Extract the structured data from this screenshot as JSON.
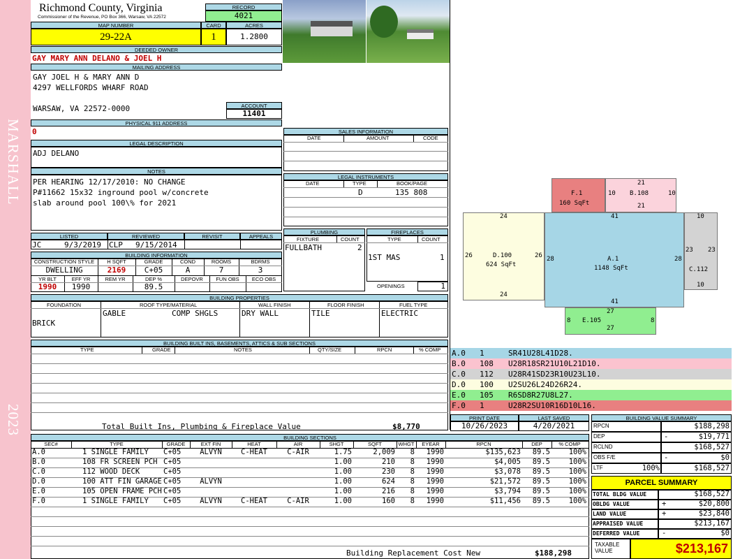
{
  "sidebar": {
    "top_text": "MARSHALL",
    "bottom_text": "2023"
  },
  "header": {
    "county": "Richmond County, Virginia",
    "commissioner": "Commissioner of the Revenue, PO Box 366, Warsaw, VA 22572",
    "record_label": "RECORD",
    "record": "4021",
    "map_number_label": "MAP NUMBER",
    "map_number": "29-22A",
    "card_label": "CARD",
    "card": "1",
    "acres_label": "ACRES",
    "acres": "1.2800"
  },
  "owner": {
    "deeded_label": "DEEDED OWNER",
    "deeded": "GAY MARY ANN DELANO & JOEL H",
    "mailing_label": "MAILING ADDRESS",
    "mailing": [
      "GAY JOEL H & MARY ANN D",
      "4297 WELLFORDS WHARF ROAD",
      "",
      "WARSAW, VA 22572-0000"
    ],
    "account_label": "ACCOUNT",
    "account": "11401",
    "physical_label": "PHYSICAL 911 ADDRESS",
    "physical": "0"
  },
  "legal": {
    "label": "LEGAL DESCRIPTION",
    "text": "ADJ DELANO"
  },
  "notes": {
    "label": "NOTES",
    "lines": [
      "PER HEARING 12/17/2010: NO CHANGE",
      "P#11662 15x32 inground pool w/concrete",
      "slab around pool 100\\% for 2021"
    ]
  },
  "review": {
    "listed_label": "LISTED",
    "listed_by": "JC",
    "listed_date": "9/3/2019",
    "reviewed_label": "REVIEWED",
    "reviewed_by": "CLP",
    "reviewed_date": "9/15/2014",
    "revisit_label": "REVISIT",
    "appeals_label": "APPEALS"
  },
  "building_info": {
    "label": "BUILDING INFORMATION",
    "headers": [
      "CONSTRUCTION STYLE",
      "H SQFT",
      "GRADE",
      "COND",
      "ROOMS",
      "BDRMS"
    ],
    "values": [
      "DWELLING",
      "2169",
      "C+05",
      "A",
      "7",
      "3"
    ],
    "headers2": [
      "YR BLT",
      "EFF YR",
      "REM YR",
      "DEP %",
      "DEPOVR",
      "FUN OBS",
      "ECO OBS"
    ],
    "values2": [
      "1990",
      "1990",
      "",
      "89.5",
      "",
      "",
      ""
    ]
  },
  "sales": {
    "label": "SALES INFORMATION",
    "headers": [
      "DATE",
      "AMOUNT",
      "CODE"
    ]
  },
  "instruments": {
    "label": "LEGAL INSTRUMENTS",
    "headers": [
      "DATE",
      "TYPE",
      "BOOK/PAGE"
    ],
    "row": [
      "",
      "D",
      "135 808"
    ]
  },
  "plumbing": {
    "label": "PLUMBING",
    "headers": [
      "FIXTURE",
      "COUNT"
    ],
    "fixture": "FULLBATH",
    "count": "2"
  },
  "fireplaces": {
    "label": "FIREPLACES",
    "headers": [
      "TYPE",
      "COUNT"
    ],
    "type": "1ST MAS",
    "count": "1",
    "openings_label": "OPENINGS",
    "openings": "1"
  },
  "properties": {
    "label": "BUILDING PROPERTIES",
    "headers": [
      "FOUNDATION",
      "ROOF TYPE/MATERIAL",
      "WALL FINISH",
      "FLOOR FINISH",
      "FUEL TYPE"
    ],
    "foundation": "BRICK",
    "roof_type": "GABLE",
    "roof_material": "COMP SHGLS",
    "wall": "DRY WALL",
    "floor": "TILE",
    "fuel": "ELECTRIC"
  },
  "builtins": {
    "label": "BUILDING BUILT INS, BASEMENTS, ATTICS & SUB SECTIONS",
    "headers": [
      "TYPE",
      "GRADE",
      "NOTES",
      "QTY/SIZE",
      "RPCN",
      "% COMP"
    ],
    "total_label": "Total Built Ins, Plumbing & Fireplace Value",
    "total": "$8,770"
  },
  "dates": {
    "print_label": "PRINT DATE",
    "print": "10/26/2023",
    "saved_label": "LAST SAVED",
    "saved": "4/20/2021"
  },
  "sections": {
    "label": "BUILDING SECTIONS",
    "headers": [
      "SEC#",
      "TYPE",
      "GRADE",
      "EXT FIN",
      "HEAT",
      "AIR",
      "SHGT",
      "SQFT",
      "WHGT",
      "EYEAR",
      "RPCN",
      "DEP",
      "% COMP"
    ],
    "rows": [
      [
        "A.0",
        "1 SINGLE FAMILY",
        "C+05",
        "ALVYN",
        "C-HEAT",
        "C-AIR",
        "1.75",
        "2,009",
        "8",
        "1990",
        "$135,623",
        "89.5",
        "100%"
      ],
      [
        "B.0",
        "108 FR SCREEN PCH",
        "C+05",
        "",
        "",
        "",
        "1.00",
        "210",
        "8",
        "1990",
        "$4,005",
        "89.5",
        "100%"
      ],
      [
        "C.0",
        "112 WOOD DECK",
        "C+05",
        "",
        "",
        "",
        "1.00",
        "230",
        "8",
        "1990",
        "$3,078",
        "89.5",
        "100%"
      ],
      [
        "D.0",
        "100 ATT FIN GARAGE",
        "C+05",
        "ALVYN",
        "",
        "",
        "1.00",
        "624",
        "8",
        "1990",
        "$21,572",
        "89.5",
        "100%"
      ],
      [
        "E.0",
        "105 OPEN FRAME PCH",
        "C+05",
        "",
        "",
        "",
        "1.00",
        "216",
        "8",
        "1990",
        "$3,794",
        "89.5",
        "100%"
      ],
      [
        "F.0",
        "1 SINGLE FAMILY",
        "C+05",
        "ALVYN",
        "C-HEAT",
        "C-AIR",
        "1.00",
        "160",
        "8",
        "1990",
        "$11,456",
        "89.5",
        "100%"
      ]
    ],
    "replacement_label": "Building Replacement Cost New",
    "replacement": "$188,298"
  },
  "sketch": {
    "areas": [
      {
        "id": "F.1",
        "sqft": "160 SqFt",
        "color": "#e88080"
      },
      {
        "id": "B.108",
        "color": "#fbd3dc"
      },
      {
        "id": "D.100",
        "sqft": "624 SqFt",
        "color": "#fdfde0"
      },
      {
        "id": "A.1",
        "sqft": "1148 SqFt",
        "color": "#a6d6e6"
      },
      {
        "id": "C.112",
        "color": "#d3d3d3"
      },
      {
        "id": "E.105",
        "color": "#90ee90"
      }
    ],
    "dims": {
      "f_left": "10",
      "b_top": "21",
      "b_left": "10",
      "b_right": "10",
      "b_bottom": "21",
      "d_top": "24",
      "d_left": "26",
      "d_right": "26",
      "d_bottom": "24",
      "a_top": "41",
      "a_left": "28",
      "a_right": "28",
      "a_bottom": "41",
      "c_top": "10",
      "c_left": "23",
      "c_right": "23",
      "c_bottom": "10",
      "e_top": "27",
      "e_left": "8",
      "e_right": "8",
      "e_bottom": "27"
    }
  },
  "segments": [
    {
      "sec": "A.0",
      "code": "1",
      "path": "SR41U28L41D28.",
      "color": "#a6d6e6"
    },
    {
      "sec": "B.0",
      "code": "108",
      "path": "U28R18SR21U10L21D10.",
      "color": "#fbc3cf"
    },
    {
      "sec": "C.0",
      "code": "112",
      "path": "U28R41SD23R10U23L10.",
      "color": "#d3d3d3"
    },
    {
      "sec": "D.0",
      "code": "100",
      "path": "U2SU26L24D26R24.",
      "color": "#fdfde0"
    },
    {
      "sec": "E.0",
      "code": "105",
      "path": "R6SD8R27U8L27.",
      "color": "#90ee90"
    },
    {
      "sec": "F.0",
      "code": "1",
      "path": "U28R2SU10R16D10L16.",
      "color": "#e88080"
    }
  ],
  "value_summary": {
    "label": "BUILDING VALUE SUMMARY",
    "rows": [
      {
        "label": "RPCN",
        "sign": "",
        "pct": "",
        "value": "$188,298"
      },
      {
        "label": "DEP",
        "sign": "-",
        "pct": "",
        "value": "$19,771"
      },
      {
        "label": "RCLND",
        "sign": "",
        "pct": "",
        "value": "$168,527"
      },
      {
        "label": "OBS F/E",
        "sign": "-",
        "pct": "",
        "value": "$0"
      },
      {
        "label": "LTF",
        "sign": "",
        "pct": "100%",
        "value": "$168,527"
      }
    ]
  },
  "parcel": {
    "label": "PARCEL SUMMARY",
    "rows": [
      {
        "label": "TOTAL BLDG VALUE",
        "sign": "",
        "value": "$168,527"
      },
      {
        "label": "OBLDG VALUE",
        "sign": "+",
        "value": "$20,800"
      },
      {
        "label": "LAND VALUE",
        "sign": "+",
        "value": "$23,840"
      },
      {
        "label": "APPRAISED VALUE",
        "sign": "",
        "value": "$213,167"
      },
      {
        "label": "DEFERRED VALUE",
        "sign": "-",
        "value": "$0"
      }
    ],
    "taxable_label": "TAXABLE VALUE",
    "taxable": "$213,167"
  }
}
